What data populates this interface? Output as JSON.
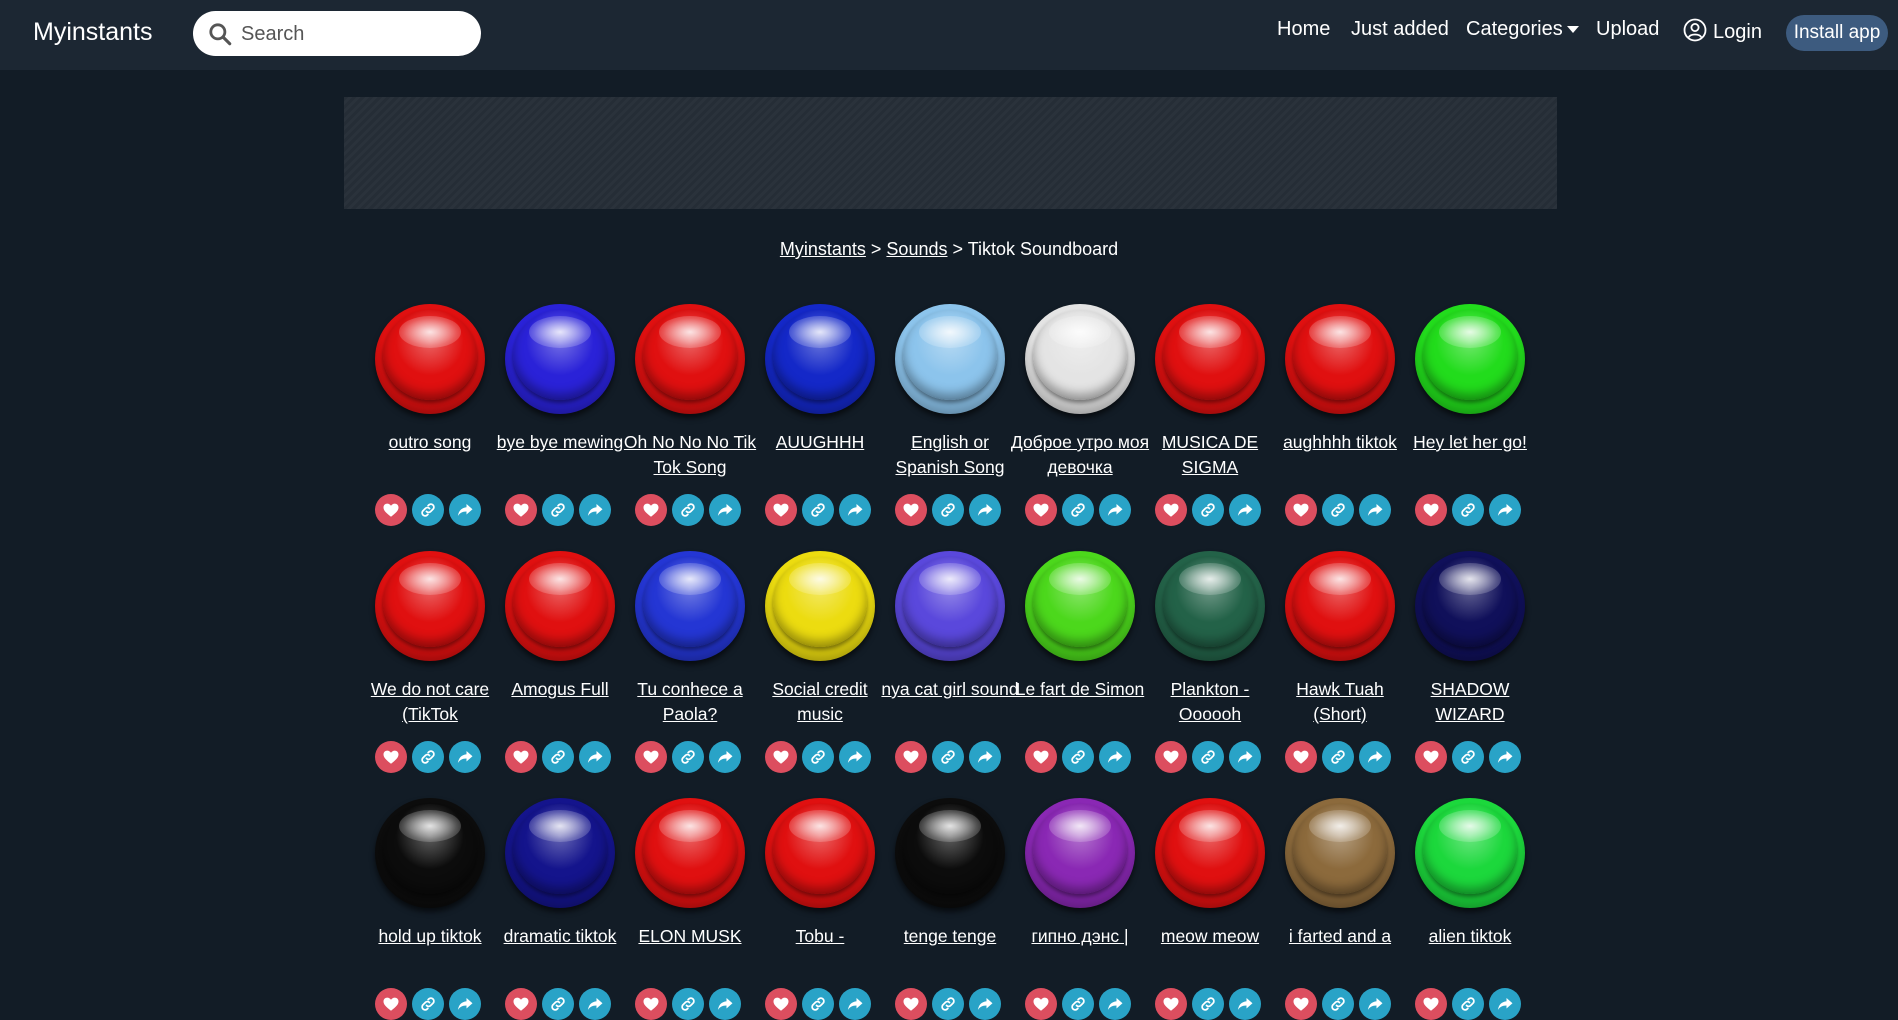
{
  "navbar": {
    "brand": "Myinstants",
    "search_placeholder": "Search",
    "links": {
      "home": "Home",
      "just_added": "Just added",
      "categories": "Categories",
      "upload": "Upload",
      "login": "Login"
    },
    "install_button": "Install app"
  },
  "breadcrumb": {
    "root": "Myinstants",
    "sep1": " > ",
    "section": "Sounds",
    "sep2": " > ",
    "current": "Tiktok Soundboard"
  },
  "colors": {
    "background": "#121c26",
    "navbar": "#1c2733",
    "favorite": "#dc4e5f",
    "action": "#29a3c7",
    "install": "#3d5b7f"
  },
  "icons": {
    "favorite": "heart-icon",
    "link": "link-icon",
    "share": "share-icon",
    "search": "search-icon",
    "user": "user-circle-icon"
  },
  "instants": [
    {
      "title": "outro song",
      "color": "#e01010"
    },
    {
      "title": "bye bye mewing",
      "color": "#2a22d8"
    },
    {
      "title": "Oh No No No Tik Tok Song",
      "color": "#e01010"
    },
    {
      "title": "AUUGHHH",
      "color": "#1428c8"
    },
    {
      "title": "English or Spanish Song",
      "color": "#8cc4ec"
    },
    {
      "title": "Доброе утро моя девочка",
      "color": "#e4e4e4"
    },
    {
      "title": "MUSICA DE SIGMA",
      "color": "#e01010"
    },
    {
      "title": "aughhhh tiktok",
      "color": "#e01010"
    },
    {
      "title": "Hey let her go!",
      "color": "#22dc1c"
    },
    {
      "title": "We do not care (TikTok",
      "color": "#e01010"
    },
    {
      "title": "Amogus Full",
      "color": "#e01010"
    },
    {
      "title": "Tu conhece a Paola?",
      "color": "#2436d4"
    },
    {
      "title": "Social credit music",
      "color": "#ecdc10"
    },
    {
      "title": "nya cat girl sound",
      "color": "#5a48dc"
    },
    {
      "title": "Le fart de Simon",
      "color": "#4cd81c"
    },
    {
      "title": "Plankton - Oooooh",
      "color": "#236248"
    },
    {
      "title": "Hawk Tuah (Short)",
      "color": "#e01010"
    },
    {
      "title": "SHADOW WIZARD",
      "color": "#10105a"
    },
    {
      "title": "hold up tiktok",
      "color": "#0c0c0c"
    },
    {
      "title": "dramatic tiktok",
      "color": "#14148c"
    },
    {
      "title": "ELON MUSK",
      "color": "#e01010"
    },
    {
      "title": "Tobu -",
      "color": "#e01010"
    },
    {
      "title": "tenge tenge",
      "color": "#0c0c0c"
    },
    {
      "title": "гипно дэнс |",
      "color": "#8a28b4"
    },
    {
      "title": "meow meow",
      "color": "#e01010"
    },
    {
      "title": "i farted and a",
      "color": "#8c6a3c"
    },
    {
      "title": "alien tiktok",
      "color": "#1cd83c"
    }
  ]
}
